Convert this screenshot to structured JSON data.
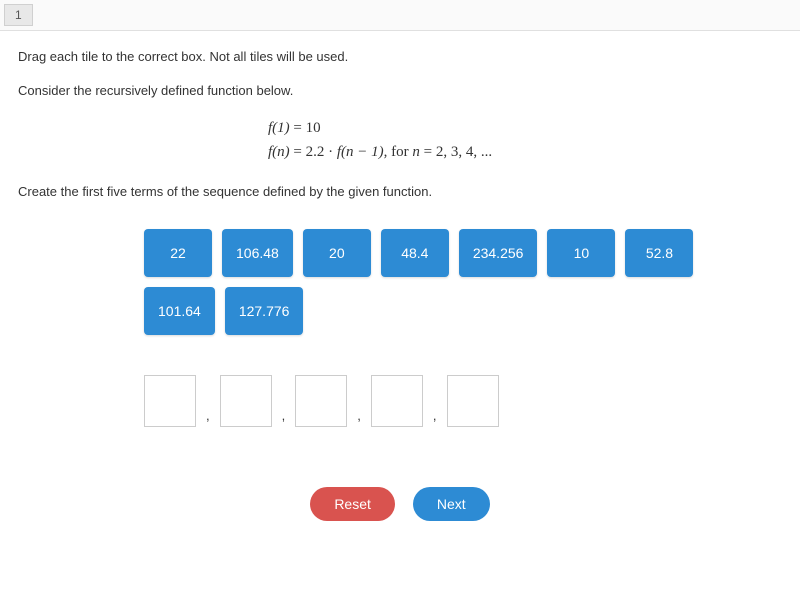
{
  "questionBar": {
    "number": "1"
  },
  "instructions": {
    "line1": "Drag each tile to the correct box. Not all tiles will be used.",
    "line2": "Consider the recursively defined function below."
  },
  "math": {
    "line1_lhs": "f(1)",
    "line1_eq": " = ",
    "line1_rhs": "10",
    "line2_lhs": "f(n)",
    "line2_eq": " = ",
    "line2_mid": "2.2 · ",
    "line2_fn": "f(n − 1)",
    "line2_tail": ", for ",
    "line2_var": "n",
    "line2_vals": " = 2, 3, 4, ..."
  },
  "subprompt": "Create the first five terms of the sequence defined by the given function.",
  "tiles": [
    {
      "label": "22"
    },
    {
      "label": "106.48"
    },
    {
      "label": "20"
    },
    {
      "label": "48.4"
    },
    {
      "label": "234.256"
    },
    {
      "label": "10"
    },
    {
      "label": "52.8"
    },
    {
      "label": "101.64"
    },
    {
      "label": "127.776"
    }
  ],
  "separators": {
    "comma": ","
  },
  "buttons": {
    "reset": "Reset",
    "next": "Next"
  }
}
